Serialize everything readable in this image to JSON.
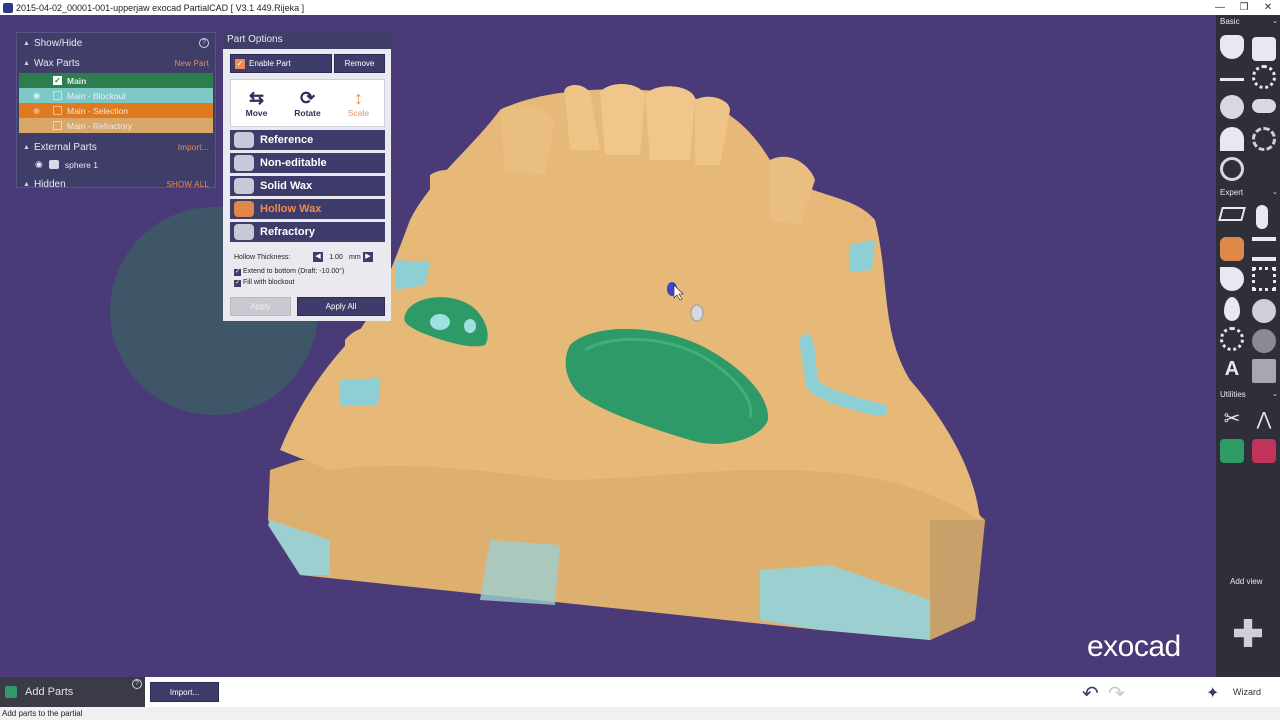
{
  "window": {
    "title": "2015-04-02_00001-001-upperjaw exocad PartialCAD [ V3.1 449.Rijeka ]"
  },
  "left_panel": {
    "show_hide": {
      "label": "Show/Hide",
      "help": "?"
    },
    "wax_parts": {
      "label": "Wax Parts",
      "action": "New Part",
      "items": [
        {
          "label": "Main",
          "checked": true,
          "color": "#2e7d4f"
        },
        {
          "label": "Main - Blockout",
          "checked": false,
          "color": "#7ec8c8"
        },
        {
          "label": "Main - Selection",
          "checked": false,
          "color": "#e07a1f"
        },
        {
          "label": "Main - Refractory",
          "checked": false,
          "color": "#d9a76a"
        }
      ]
    },
    "external_parts": {
      "label": "External Parts",
      "action": "Import...",
      "items": [
        {
          "label": "sphere 1"
        }
      ]
    },
    "hidden": {
      "label": "Hidden",
      "action": "SHOW ALL"
    }
  },
  "part_options": {
    "title": "Part Options",
    "enable_part": {
      "label": "Enable Part",
      "checked": true
    },
    "remove": "Remove",
    "transform": [
      {
        "label": "Move",
        "icon": "move-arrows-icon",
        "active": false
      },
      {
        "label": "Rotate",
        "icon": "rotate-arrows-icon",
        "active": false
      },
      {
        "label": "Scale",
        "icon": "scale-arrows-icon",
        "active": true
      }
    ],
    "modes": [
      {
        "label": "Reference",
        "active": false
      },
      {
        "label": "Non-editable",
        "active": false
      },
      {
        "label": "Solid Wax",
        "active": false
      },
      {
        "label": "Hollow Wax",
        "active": true
      },
      {
        "label": "Refractory",
        "active": false
      }
    ],
    "hollow_thickness": {
      "label": "Hollow Thickness:",
      "value": "1.00",
      "unit": "mm"
    },
    "extend_to_bottom": {
      "label": "Extend to bottom (Draft: -10.00°)",
      "checked": true
    },
    "fill_with_blockout": {
      "label": "Fill with blockout",
      "checked": true
    },
    "apply": "Apply",
    "apply_all": "Apply All"
  },
  "right_toolbar": {
    "sections": [
      {
        "label": "Basic"
      },
      {
        "label": "Expert"
      },
      {
        "label": "Utilities"
      }
    ],
    "add_view": "Add view"
  },
  "bottom": {
    "add_parts": "Add Parts",
    "help": "?",
    "import": "Import...",
    "wizard": "Wizard"
  },
  "status": "Add parts to the partial",
  "brand": "exocad",
  "colors": {
    "background": "#4a3a78",
    "panel": "#3f3e69",
    "accent_orange": "#f18a4e",
    "model_tan": "#e4b877",
    "wax_green": "#2e9a68",
    "blockout_cyan": "#8ecfd6"
  }
}
